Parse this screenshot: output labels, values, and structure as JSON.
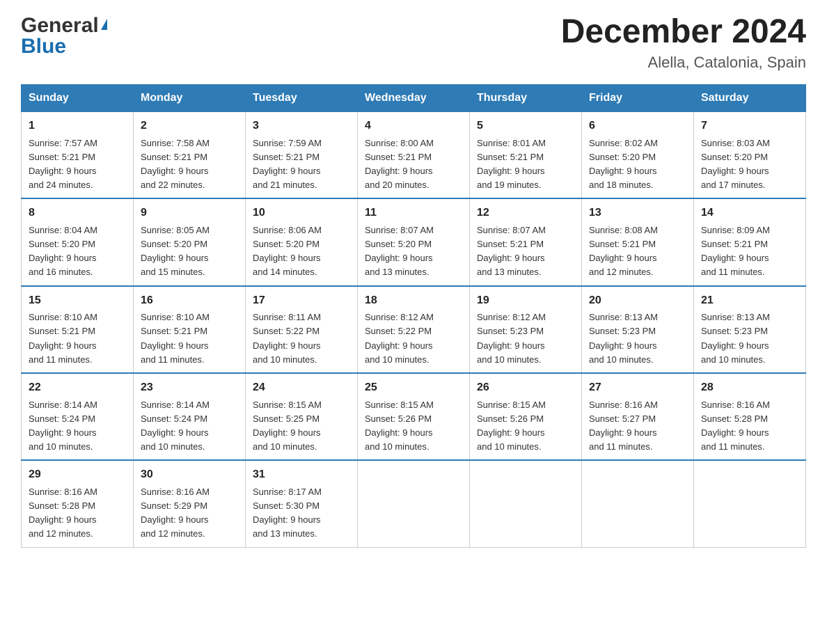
{
  "header": {
    "month_title": "December 2024",
    "location": "Alella, Catalonia, Spain",
    "logo_line1": "General",
    "logo_line2": "Blue"
  },
  "weekdays": [
    "Sunday",
    "Monday",
    "Tuesday",
    "Wednesday",
    "Thursday",
    "Friday",
    "Saturday"
  ],
  "rows": [
    [
      {
        "day": "1",
        "info": "Sunrise: 7:57 AM\nSunset: 5:21 PM\nDaylight: 9 hours\nand 24 minutes."
      },
      {
        "day": "2",
        "info": "Sunrise: 7:58 AM\nSunset: 5:21 PM\nDaylight: 9 hours\nand 22 minutes."
      },
      {
        "day": "3",
        "info": "Sunrise: 7:59 AM\nSunset: 5:21 PM\nDaylight: 9 hours\nand 21 minutes."
      },
      {
        "day": "4",
        "info": "Sunrise: 8:00 AM\nSunset: 5:21 PM\nDaylight: 9 hours\nand 20 minutes."
      },
      {
        "day": "5",
        "info": "Sunrise: 8:01 AM\nSunset: 5:21 PM\nDaylight: 9 hours\nand 19 minutes."
      },
      {
        "day": "6",
        "info": "Sunrise: 8:02 AM\nSunset: 5:20 PM\nDaylight: 9 hours\nand 18 minutes."
      },
      {
        "day": "7",
        "info": "Sunrise: 8:03 AM\nSunset: 5:20 PM\nDaylight: 9 hours\nand 17 minutes."
      }
    ],
    [
      {
        "day": "8",
        "info": "Sunrise: 8:04 AM\nSunset: 5:20 PM\nDaylight: 9 hours\nand 16 minutes."
      },
      {
        "day": "9",
        "info": "Sunrise: 8:05 AM\nSunset: 5:20 PM\nDaylight: 9 hours\nand 15 minutes."
      },
      {
        "day": "10",
        "info": "Sunrise: 8:06 AM\nSunset: 5:20 PM\nDaylight: 9 hours\nand 14 minutes."
      },
      {
        "day": "11",
        "info": "Sunrise: 8:07 AM\nSunset: 5:20 PM\nDaylight: 9 hours\nand 13 minutes."
      },
      {
        "day": "12",
        "info": "Sunrise: 8:07 AM\nSunset: 5:21 PM\nDaylight: 9 hours\nand 13 minutes."
      },
      {
        "day": "13",
        "info": "Sunrise: 8:08 AM\nSunset: 5:21 PM\nDaylight: 9 hours\nand 12 minutes."
      },
      {
        "day": "14",
        "info": "Sunrise: 8:09 AM\nSunset: 5:21 PM\nDaylight: 9 hours\nand 11 minutes."
      }
    ],
    [
      {
        "day": "15",
        "info": "Sunrise: 8:10 AM\nSunset: 5:21 PM\nDaylight: 9 hours\nand 11 minutes."
      },
      {
        "day": "16",
        "info": "Sunrise: 8:10 AM\nSunset: 5:21 PM\nDaylight: 9 hours\nand 11 minutes."
      },
      {
        "day": "17",
        "info": "Sunrise: 8:11 AM\nSunset: 5:22 PM\nDaylight: 9 hours\nand 10 minutes."
      },
      {
        "day": "18",
        "info": "Sunrise: 8:12 AM\nSunset: 5:22 PM\nDaylight: 9 hours\nand 10 minutes."
      },
      {
        "day": "19",
        "info": "Sunrise: 8:12 AM\nSunset: 5:23 PM\nDaylight: 9 hours\nand 10 minutes."
      },
      {
        "day": "20",
        "info": "Sunrise: 8:13 AM\nSunset: 5:23 PM\nDaylight: 9 hours\nand 10 minutes."
      },
      {
        "day": "21",
        "info": "Sunrise: 8:13 AM\nSunset: 5:23 PM\nDaylight: 9 hours\nand 10 minutes."
      }
    ],
    [
      {
        "day": "22",
        "info": "Sunrise: 8:14 AM\nSunset: 5:24 PM\nDaylight: 9 hours\nand 10 minutes."
      },
      {
        "day": "23",
        "info": "Sunrise: 8:14 AM\nSunset: 5:24 PM\nDaylight: 9 hours\nand 10 minutes."
      },
      {
        "day": "24",
        "info": "Sunrise: 8:15 AM\nSunset: 5:25 PM\nDaylight: 9 hours\nand 10 minutes."
      },
      {
        "day": "25",
        "info": "Sunrise: 8:15 AM\nSunset: 5:26 PM\nDaylight: 9 hours\nand 10 minutes."
      },
      {
        "day": "26",
        "info": "Sunrise: 8:15 AM\nSunset: 5:26 PM\nDaylight: 9 hours\nand 10 minutes."
      },
      {
        "day": "27",
        "info": "Sunrise: 8:16 AM\nSunset: 5:27 PM\nDaylight: 9 hours\nand 11 minutes."
      },
      {
        "day": "28",
        "info": "Sunrise: 8:16 AM\nSunset: 5:28 PM\nDaylight: 9 hours\nand 11 minutes."
      }
    ],
    [
      {
        "day": "29",
        "info": "Sunrise: 8:16 AM\nSunset: 5:28 PM\nDaylight: 9 hours\nand 12 minutes."
      },
      {
        "day": "30",
        "info": "Sunrise: 8:16 AM\nSunset: 5:29 PM\nDaylight: 9 hours\nand 12 minutes."
      },
      {
        "day": "31",
        "info": "Sunrise: 8:17 AM\nSunset: 5:30 PM\nDaylight: 9 hours\nand 13 minutes."
      },
      {
        "day": "",
        "info": ""
      },
      {
        "day": "",
        "info": ""
      },
      {
        "day": "",
        "info": ""
      },
      {
        "day": "",
        "info": ""
      }
    ]
  ]
}
